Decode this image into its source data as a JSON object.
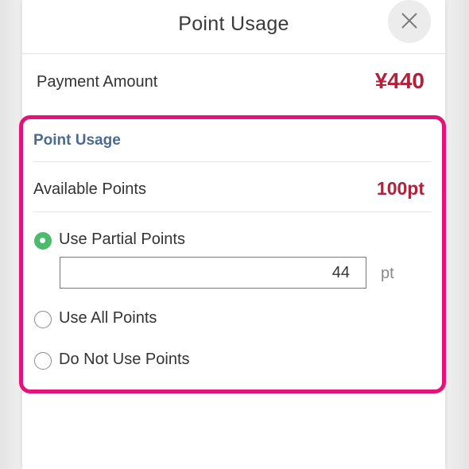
{
  "dialog": {
    "title": "Point Usage",
    "close_icon": "close-icon"
  },
  "payment": {
    "label": "Payment Amount",
    "amount": "¥440"
  },
  "point_section": {
    "title": "Point Usage",
    "available_label": "Available Points",
    "available_value": "100pt",
    "options": [
      {
        "label": "Use Partial Points",
        "selected": true
      },
      {
        "label": "Use All Points",
        "selected": false
      },
      {
        "label": "Do Not Use Points",
        "selected": false
      }
    ],
    "partial_input_value": "44",
    "unit": "pt"
  },
  "colors": {
    "accent_red": "#b0213b",
    "highlight_border": "#e0147a",
    "radio_selected": "#4cbb6c",
    "section_title": "#4a6a93"
  }
}
